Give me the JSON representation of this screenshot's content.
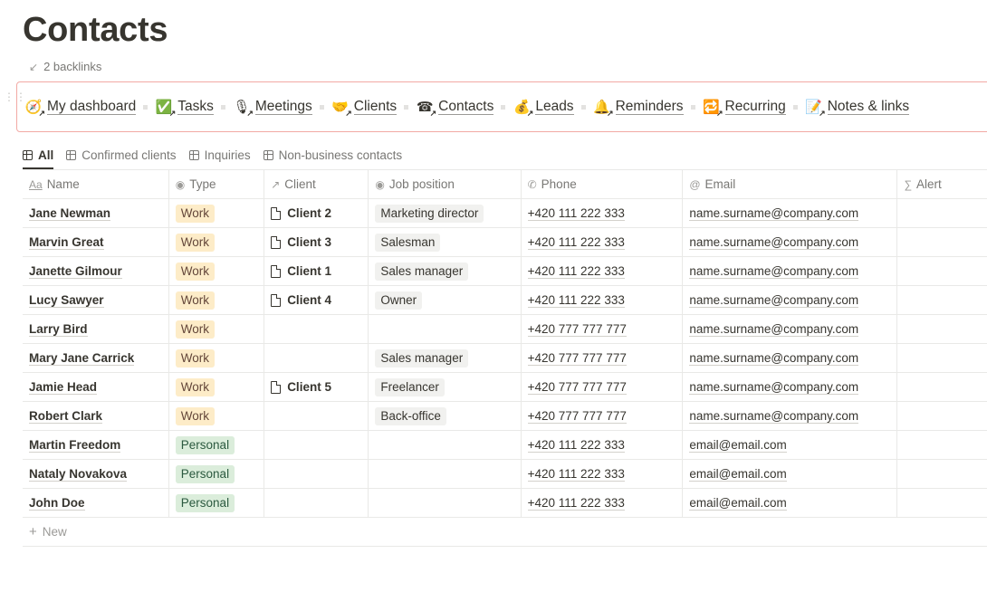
{
  "page": {
    "title": "Contacts",
    "backlinks": "2 backlinks"
  },
  "nav": [
    {
      "label": "My dashboard",
      "icon": "dashboard-icon",
      "glyph": "🧭"
    },
    {
      "label": "Tasks",
      "icon": "checkbox-icon",
      "glyph": "✅"
    },
    {
      "label": "Meetings",
      "icon": "microphone-icon",
      "glyph": "🎙"
    },
    {
      "label": "Clients",
      "icon": "handshake-icon",
      "glyph": "🤝"
    },
    {
      "label": "Contacts",
      "icon": "telephone-icon",
      "glyph": "☎"
    },
    {
      "label": "Leads",
      "icon": "money-bag-icon",
      "glyph": "💰"
    },
    {
      "label": "Reminders",
      "icon": "bell-icon",
      "glyph": "🔔"
    },
    {
      "label": "Recurring",
      "icon": "repeat-icon",
      "glyph": "🔁"
    },
    {
      "label": "Notes & links",
      "icon": "memo-icon",
      "glyph": "📝"
    }
  ],
  "tabs": [
    "All",
    "Confirmed clients",
    "Inquiries",
    "Non-business contacts"
  ],
  "columns": {
    "name": "Name",
    "type": "Type",
    "client": "Client",
    "job": "Job position",
    "phone": "Phone",
    "email": "Email",
    "alert": "Alert"
  },
  "rows": [
    {
      "name": "Jane Newman",
      "type": "Work",
      "client": "Client 2",
      "job": "Marketing director",
      "phone": "+420 111 222 333",
      "email": "name.surname@company.com"
    },
    {
      "name": "Marvin Great",
      "type": "Work",
      "client": "Client 3",
      "job": "Salesman",
      "phone": "+420 111 222 333",
      "email": "name.surname@company.com"
    },
    {
      "name": "Janette Gilmour",
      "type": "Work",
      "client": "Client 1",
      "job": "Sales manager",
      "phone": "+420 111 222 333",
      "email": "name.surname@company.com"
    },
    {
      "name": "Lucy Sawyer",
      "type": "Work",
      "client": "Client 4",
      "job": "Owner",
      "phone": "+420 111 222 333",
      "email": "name.surname@company.com"
    },
    {
      "name": "Larry Bird",
      "type": "Work",
      "client": "",
      "job": "",
      "phone": "+420 777 777 777",
      "email": "name.surname@company.com"
    },
    {
      "name": "Mary Jane Carrick",
      "type": "Work",
      "client": "",
      "job": "Sales manager",
      "phone": "+420 777 777 777",
      "email": "name.surname@company.com"
    },
    {
      "name": "Jamie Head",
      "type": "Work",
      "client": "Client 5",
      "job": "Freelancer",
      "phone": "+420 777 777 777",
      "email": "name.surname@company.com"
    },
    {
      "name": "Robert Clark",
      "type": "Work",
      "client": "",
      "job": "Back-office",
      "phone": "+420 777 777 777",
      "email": "name.surname@company.com"
    },
    {
      "name": "Martin Freedom",
      "type": "Personal",
      "client": "",
      "job": "",
      "phone": "+420 111 222 333",
      "email": "email@email.com"
    },
    {
      "name": "Nataly Novakova",
      "type": "Personal",
      "client": "",
      "job": "",
      "phone": "+420 111 222 333",
      "email": "email@email.com"
    },
    {
      "name": "John Doe",
      "type": "Personal",
      "client": "",
      "job": "",
      "phone": "+420 111 222 333",
      "email": "email@email.com"
    }
  ],
  "new_label": "New",
  "colors": {
    "work_tag_bg": "#fdecc8",
    "personal_tag_bg": "#dbeddb",
    "nav_border": "#f2a9a4"
  }
}
